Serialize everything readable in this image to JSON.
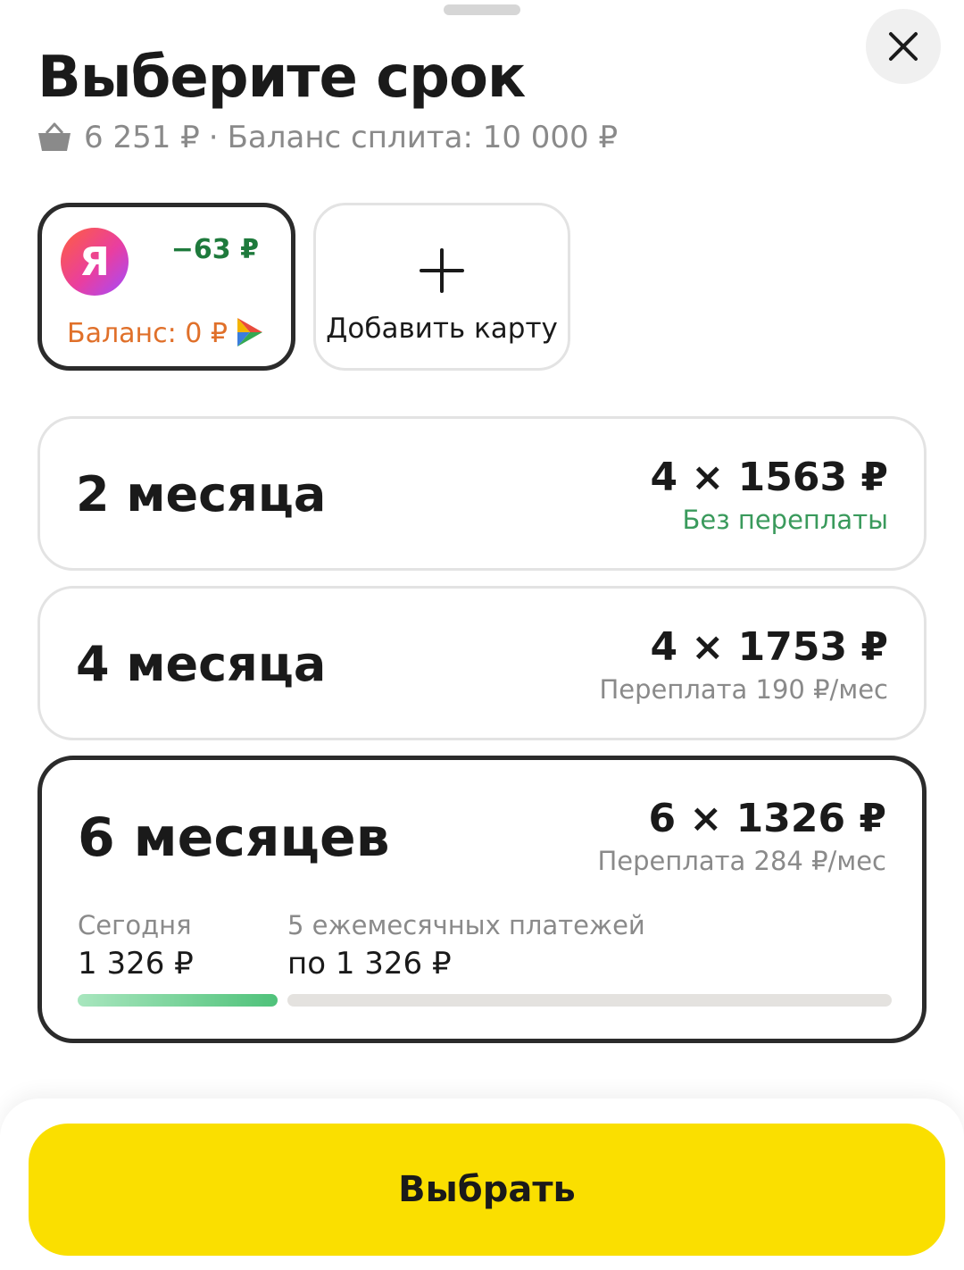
{
  "header": {
    "title": "Выберите срок",
    "order_total": "6 251 ₽",
    "separator": "·",
    "split_balance": "Баланс сплита: 10 000 ₽",
    "close_icon": "close-icon",
    "basket_icon": "basket-icon"
  },
  "payment_methods": {
    "yandex_card": {
      "logo_letter": "Я",
      "discount": "−63 ₽",
      "balance": "Баланс: 0 ₽",
      "brand_icon": "triangle-logo-icon"
    },
    "add_card": {
      "label": "Добавить карту",
      "icon": "plus-icon"
    }
  },
  "plans": [
    {
      "term": "2 месяца",
      "amount": "4 × 1563 ₽",
      "note": "Без переплаты",
      "selected": false
    },
    {
      "term": "4 месяца",
      "amount": "4 × 1753 ₽",
      "note": "Переплата 190 ₽/мес",
      "selected": false
    },
    {
      "term": "6 месяцев",
      "amount": "6 × 1326 ₽",
      "note": "Переплата 284 ₽/мес",
      "selected": true,
      "schedule": {
        "today_label": "Сегодня",
        "today_value": "1 326 ₽",
        "rest_label": "5 ежемесячных платежей",
        "rest_value": "по 1 326 ₽"
      }
    }
  ],
  "footer": {
    "choose_label": "Выбрать"
  },
  "colors": {
    "accent_yellow": "#fadf00",
    "discount_green": "#1e7a3c",
    "no_overpay_green": "#3a9a5c",
    "balance_orange": "#e0702a",
    "selected_border": "#2b2b2b"
  }
}
